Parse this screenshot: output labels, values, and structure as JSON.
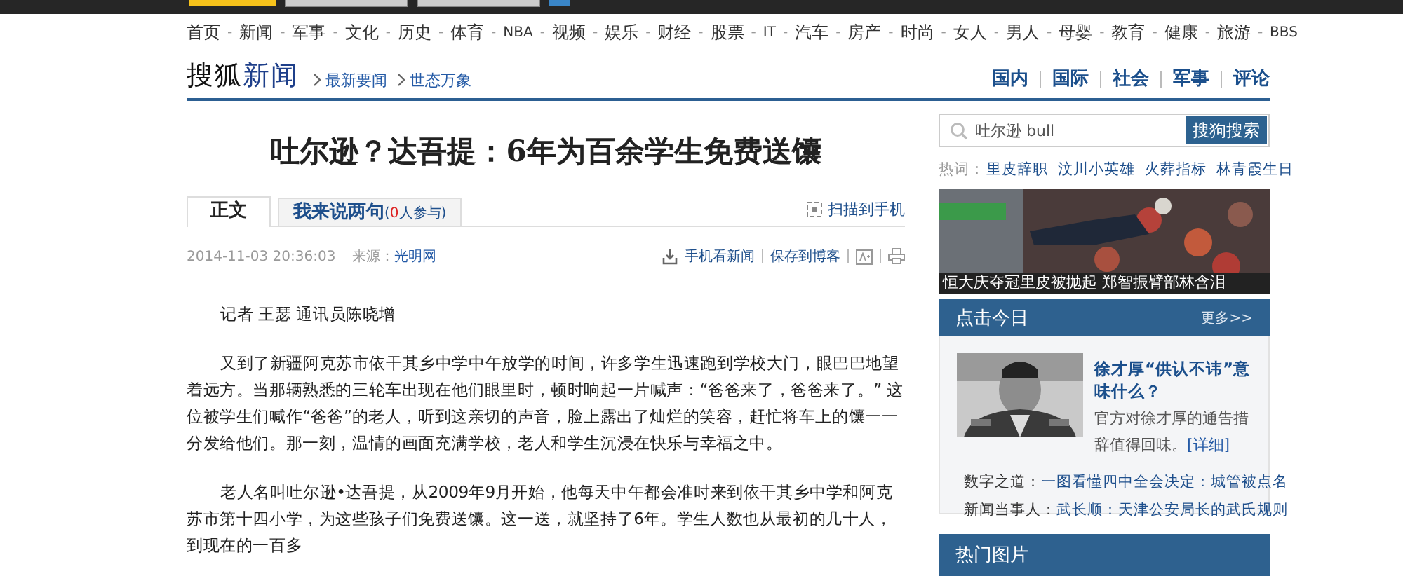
{
  "nav": {
    "separator": "-",
    "items": [
      "首页",
      "新闻",
      "军事",
      "文化",
      "历史",
      "体育",
      "NBA",
      "视频",
      "娱乐",
      "财经",
      "股票",
      "IT",
      "汽车",
      "房产",
      "时尚",
      "女人",
      "男人",
      "母婴",
      "教育",
      "健康",
      "旅游",
      "BBS"
    ]
  },
  "header": {
    "logo_parts": [
      "搜狐",
      "新闻"
    ],
    "breadcrumb": [
      "最新要闻",
      "世态万象"
    ],
    "channels": [
      "国内",
      "国际",
      "社会",
      "军事",
      "评论"
    ]
  },
  "article": {
    "title": "吐尔逊？达吾提：6年为百余学生免费送馕",
    "tabs": [
      {
        "label": "正文",
        "selected": true
      },
      {
        "label": "我来说两句",
        "note_before": "(",
        "count": "0",
        "note_after": "人参与)",
        "selected": false
      }
    ],
    "scan_link": "扫描到手机",
    "date": "2014-11-03 20:36:03",
    "source_label": "来源：",
    "source": "光明网",
    "actions": [
      "手机看新闻",
      "保存到博客"
    ],
    "paragraphs": [
      "记者 王瑟 通讯员陈晓增",
      "又到了新疆阿克苏市依干其乡中学中午放学的时间，许多学生迅速跑到学校大门，眼巴巴地望着远方。当那辆熟悉的三轮车出现在他们眼里时，顿时响起一片喊声：“爸爸来了，爸爸来了。” 这位被学生们喊作“爸爸”的老人，听到这亲切的声音，脸上露出了灿烂的笑容，赶忙将车上的馕一一分发给他们。那一刻，温情的画面充满学校，老人和学生沉浸在快乐与幸福之中。",
      "老人名叫吐尔逊•达吾提，从2009年9月开始，他每天中午都会准时来到依干其乡中学和阿克苏市第十四小学，为这些孩子们免费送馕。这一送，就坚持了6年。学生人数也从最初的几十人，到现在的一百多"
    ]
  },
  "sidebar": {
    "search": {
      "value": "吐尔逊 bull",
      "button": "搜狗搜索"
    },
    "hot_label": "热词：",
    "hot_words": [
      "里皮辞职",
      "汶川小英雄",
      "火葬指标",
      "林青霞生日"
    ],
    "photo": {
      "kind": "picture",
      "caption": "恒大庆夺冠里皮被抛起 郑智振臂部林含泪"
    },
    "today": {
      "title": "点击今日",
      "more": "更多>>",
      "feature": {
        "kind": "picture",
        "title": "徐才厚“供认不讳”意味什么？",
        "summary": "官方对徐才厚的通告措辞值得回味。",
        "detail": "[详细]"
      },
      "items": [
        {
          "label": "数字之道：",
          "link": "一图看懂四中全会决定：城管被点名"
        },
        {
          "label": "新闻当事人：",
          "link": "武长顺：天津公安局长的武氏规则"
        }
      ]
    },
    "hot_pictures": {
      "title": "热门图片"
    }
  }
}
